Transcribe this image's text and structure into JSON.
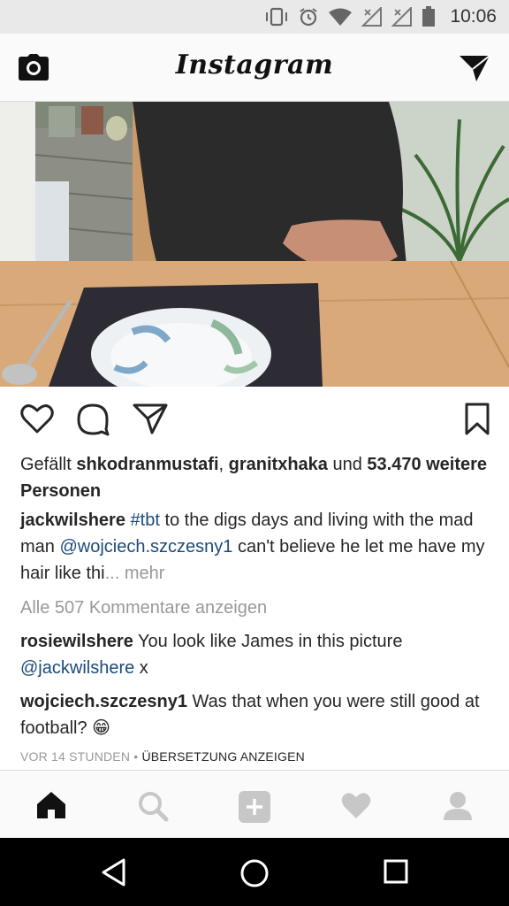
{
  "status_bar": {
    "time": "10:06",
    "icons": [
      "vibrate-icon",
      "alarm-icon",
      "wifi-icon",
      "signal-icon",
      "signal-icon",
      "battery-icon"
    ]
  },
  "header": {
    "title": "Instagram",
    "left_icon": "camera-icon",
    "right_icon": "direct-message-icon"
  },
  "post": {
    "likes": {
      "prefix": "Gefällt ",
      "user1": "shkodranmustafi",
      "sep": ", ",
      "user2": "granitxhaka",
      "und": " und ",
      "count_text": "53.470 weitere Personen"
    },
    "caption": {
      "author": "jackwilshere",
      "hashtag": "#tbt",
      "text1": " to the digs days and living with the mad man ",
      "mention": "@wojciech.szczesny1",
      "text2": " can't believe he let me have my hair like thi",
      "more": "... mehr"
    },
    "view_all_comments": "Alle 507 Kommentare anzeigen",
    "comments": [
      {
        "author": "rosiewilshere",
        "text": " You look like James in this picture ",
        "mention": "@jackwilshere",
        "tail": " x"
      },
      {
        "author": "wojciech.szczesny1",
        "text": " Was that when you were still good at football? ",
        "emoji": "😁"
      }
    ],
    "timestamp": "VOR 14 STUNDEN",
    "dot": " • ",
    "translate": "ÜBERSETZUNG ANZEIGEN"
  },
  "action_icons": [
    "like-icon",
    "comment-icon",
    "share-icon",
    "save-icon"
  ],
  "tabs": [
    "home-icon",
    "search-icon",
    "add-post-icon",
    "activity-icon",
    "profile-icon"
  ],
  "system_nav": [
    "back-icon",
    "home-circle-icon",
    "recents-icon"
  ]
}
